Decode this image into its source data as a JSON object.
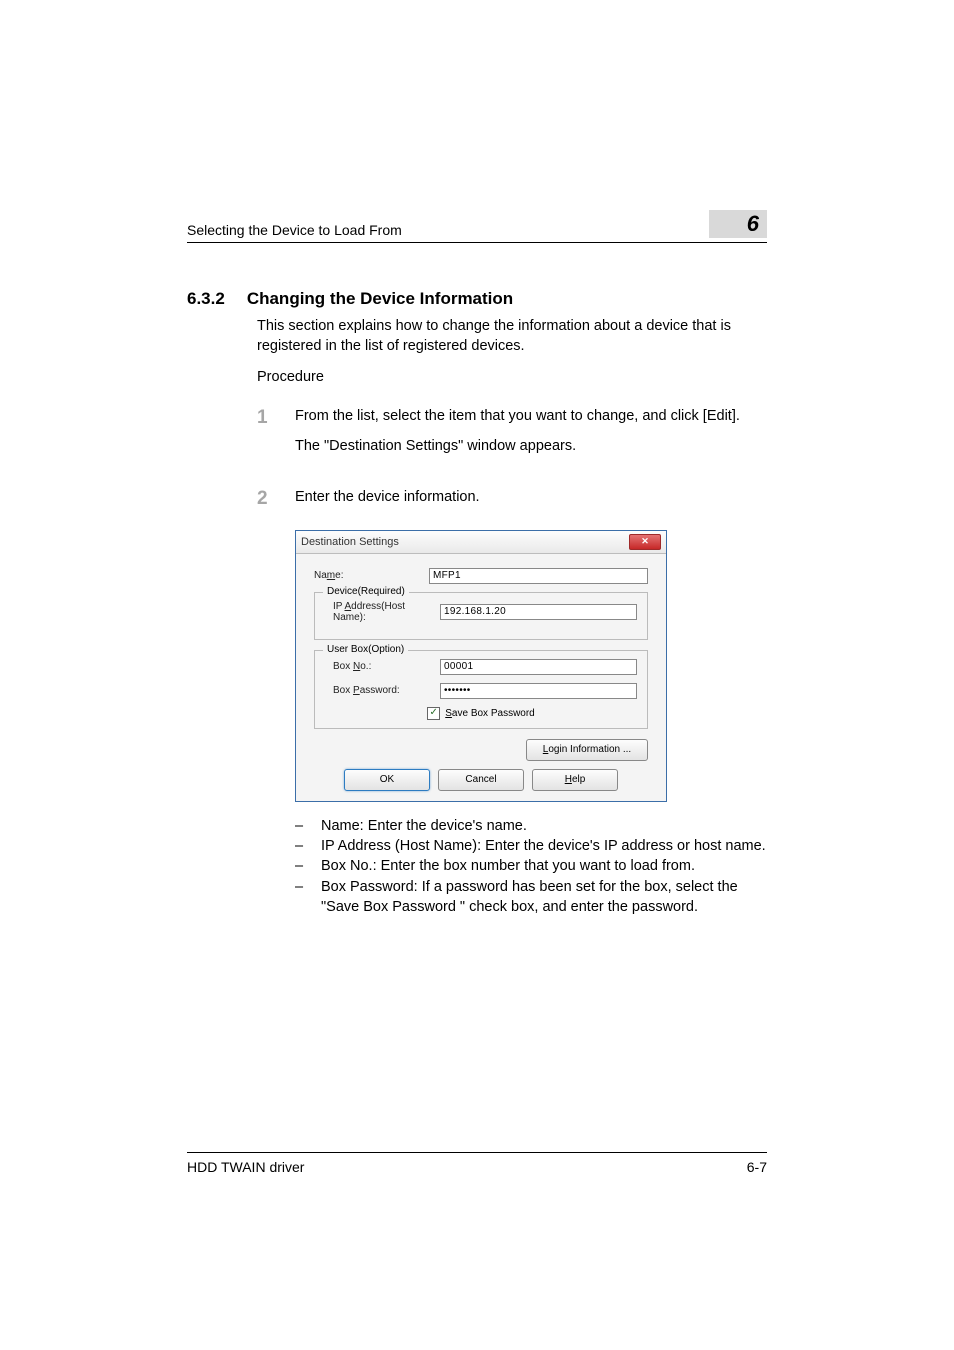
{
  "header": {
    "left": "Selecting the Device to Load From",
    "chapter": "6"
  },
  "section": {
    "number": "6.3.2",
    "title": "Changing the Device Information",
    "intro": "This section explains how to change the information about a device that is registered in the list of registered devices.",
    "procedure_label": "Procedure"
  },
  "steps": [
    {
      "num": "1",
      "lines": [
        "From the list, select the item that you want to change, and click [Edit].",
        "The \"Destination Settings\" window appears."
      ]
    },
    {
      "num": "2",
      "lines": [
        "Enter the device information."
      ]
    }
  ],
  "dialog": {
    "title": "Destination Settings",
    "name_label_prefix": "Na",
    "name_label_u": "m",
    "name_label_suffix": "e:",
    "name_value": "MFP1",
    "device_group": "Device(Required)",
    "ip_label_prefix": "IP ",
    "ip_label_u": "A",
    "ip_label_suffix": "ddress(Host Name):",
    "ip_value": "192.168.1.20",
    "userbox_group": "User Box(Option)",
    "boxno_label_prefix": "Box ",
    "boxno_label_u": "N",
    "boxno_label_suffix": "o.:",
    "boxno_value": "00001",
    "boxpw_label_prefix": "Box ",
    "boxpw_label_u": "P",
    "boxpw_label_suffix": "assword:",
    "boxpw_value": "•••••••",
    "save_pw_u": "S",
    "save_pw_label": "ave Box Password",
    "login_btn_u": "L",
    "login_btn": "ogin Information ...",
    "ok_btn": "OK",
    "cancel_btn": "Cancel",
    "help_btn_u": "H",
    "help_btn": "elp"
  },
  "bullets": [
    "Name: Enter the device's name.",
    "IP Address (Host Name): Enter the device's IP address or host name.",
    "Box No.: Enter the box number that you want to load from.",
    "Box Password: If a password has been set for the box, select the \"Save Box Password \" check box, and enter the password."
  ],
  "footer": {
    "left": "HDD TWAIN driver",
    "right": "6-7"
  }
}
